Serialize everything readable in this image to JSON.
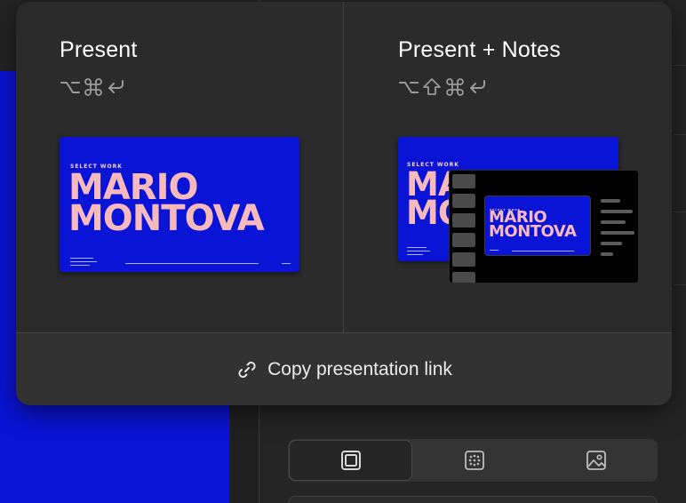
{
  "popover": {
    "present": {
      "title": "Present",
      "shortcut": [
        "option-key-icon",
        "command-key-icon",
        "return-key-icon"
      ]
    },
    "present_notes": {
      "title": "Present + Notes",
      "shortcut": [
        "option-key-icon",
        "shift-key-icon",
        "command-key-icon",
        "return-key-icon"
      ]
    },
    "footer": {
      "label": "Copy presentation link",
      "icon": "link-icon"
    }
  },
  "slide_thumbnail": {
    "eyebrow": "SELECT WORK",
    "name_line1": "MARIO",
    "name_line2": "MONTOVA"
  },
  "background": {
    "fill_options": [
      "solid-fill-icon",
      "pattern-fill-icon",
      "image-fill-icon"
    ],
    "selected_fill": "solid-fill-icon"
  },
  "colors": {
    "slide_blue": "#0a14d6",
    "slide_text_pink": "#f7b9bb",
    "popover_bg": "#2b2b2b"
  }
}
